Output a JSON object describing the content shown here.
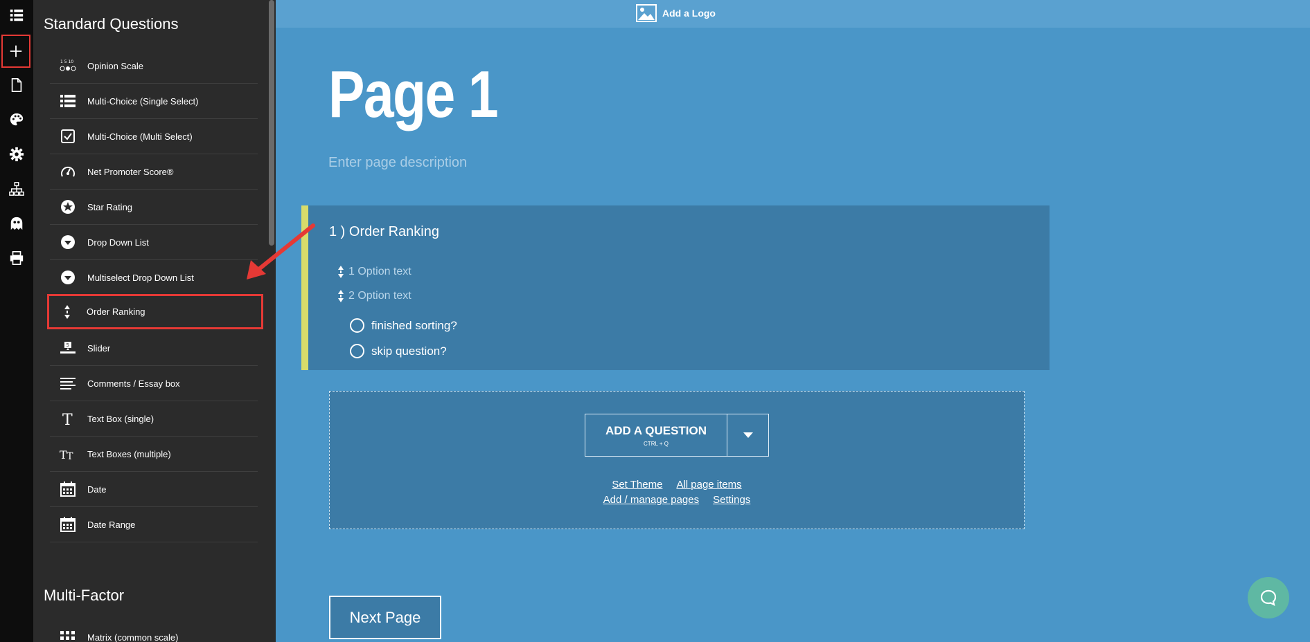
{
  "rail": {
    "items": [
      {
        "name": "list-icon"
      },
      {
        "name": "add-icon"
      },
      {
        "name": "page-icon"
      },
      {
        "name": "palette-icon"
      },
      {
        "name": "gear-icon"
      },
      {
        "name": "sitemap-icon"
      },
      {
        "name": "ghost-icon"
      },
      {
        "name": "print-icon"
      }
    ]
  },
  "sidebar": {
    "standard_title": "Standard Questions",
    "standard_items": [
      {
        "label": "Opinion Scale",
        "icon": "opinion-scale-icon"
      },
      {
        "label": "Multi-Choice (Single Select)",
        "icon": "list-icon"
      },
      {
        "label": "Multi-Choice (Multi Select)",
        "icon": "checkbox-icon"
      },
      {
        "label": "Net Promoter Score®",
        "icon": "gauge-icon"
      },
      {
        "label": "Star Rating",
        "icon": "star-icon"
      },
      {
        "label": "Drop Down List",
        "icon": "dropdown-icon"
      },
      {
        "label": "Multiselect Drop Down List",
        "icon": "dropdown-icon"
      },
      {
        "label": "Order Ranking",
        "icon": "sort-icon"
      },
      {
        "label": "Slider",
        "icon": "slider-icon"
      },
      {
        "label": "Comments / Essay box",
        "icon": "paragraph-icon"
      },
      {
        "label": "Text Box (single)",
        "icon": "text-icon"
      },
      {
        "label": "Text Boxes (multiple)",
        "icon": "text-multi-icon"
      },
      {
        "label": "Date",
        "icon": "calendar-icon"
      },
      {
        "label": "Date Range",
        "icon": "calendar-icon"
      }
    ],
    "multifactor_title": "Multi-Factor",
    "multifactor_items": [
      {
        "label": "Matrix (common scale)",
        "icon": "grid-icon"
      }
    ]
  },
  "logo_bar": {
    "label": "Add a Logo"
  },
  "page": {
    "title": "Page 1",
    "description_placeholder": "Enter page description"
  },
  "question": {
    "title": "1 )  Order Ranking",
    "options": [
      "1 Option text",
      "2 Option text"
    ],
    "radios": [
      "finished sorting?",
      "skip question?"
    ]
  },
  "add_question": {
    "label": "ADD A QUESTION",
    "shortcut": "CTRL + Q",
    "links_row1": [
      "Set Theme",
      "All page items"
    ],
    "links_row2": [
      "Add / manage pages",
      "Settings"
    ]
  },
  "next_button": "Next Page",
  "colors": {
    "background": "#4a96c8",
    "card": "#3c7ba6",
    "accent_bar": "#d8dc6a",
    "highlight_red": "#e53935",
    "chat": "#5fb8a3"
  }
}
